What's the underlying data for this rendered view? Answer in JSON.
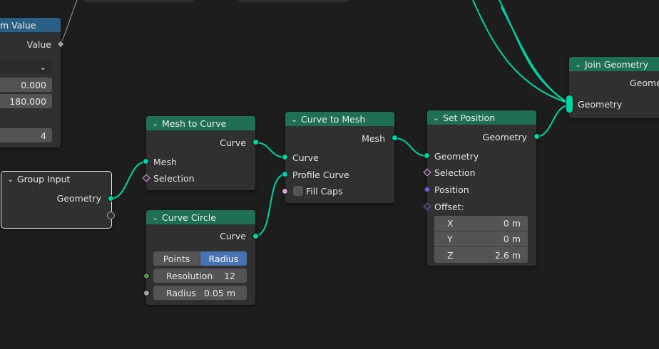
{
  "colors": {
    "background": "#1d1d1d",
    "node_body": "#303030",
    "geometry_header": "#1f6f57",
    "input_header": "#2a5f86",
    "geometry_socket": "#00d6a3",
    "field_bg": "#545454",
    "active_toggle": "#4772b3"
  },
  "random_value_node": {
    "title": "m Value",
    "output_label": "Value",
    "fields": [
      "0.000",
      "180.000",
      "4"
    ]
  },
  "mesh_to_curve_node": {
    "title": "Mesh to Curve",
    "output": "Curve",
    "inputs": [
      "Mesh",
      "Selection"
    ]
  },
  "group_input_node": {
    "title": "Group Input",
    "output": "Geometry"
  },
  "curve_circle_node": {
    "title": "Curve Circle",
    "output": "Curve",
    "mode_options": [
      "Points",
      "Radius"
    ],
    "mode_selected": "Radius",
    "resolution_label": "Resolution",
    "resolution_value": "12",
    "radius_label": "Radius",
    "radius_value": "0.05 m"
  },
  "curve_to_mesh_node": {
    "title": "Curve to Mesh",
    "output": "Mesh",
    "inputs": [
      "Curve",
      "Profile Curve"
    ],
    "fill_caps_label": "Fill Caps"
  },
  "set_position_node": {
    "title": "Set Position",
    "output": "Geometry",
    "inputs": [
      "Geometry",
      "Selection",
      "Position",
      "Offset:"
    ],
    "offset": [
      {
        "axis": "X",
        "value": "0 m"
      },
      {
        "axis": "Y",
        "value": "0 m"
      },
      {
        "axis": "Z",
        "value": "2.6 m"
      }
    ]
  },
  "join_geometry_node": {
    "title": "Join Geometry",
    "output_partial": "Geome",
    "input": "Geometry"
  }
}
